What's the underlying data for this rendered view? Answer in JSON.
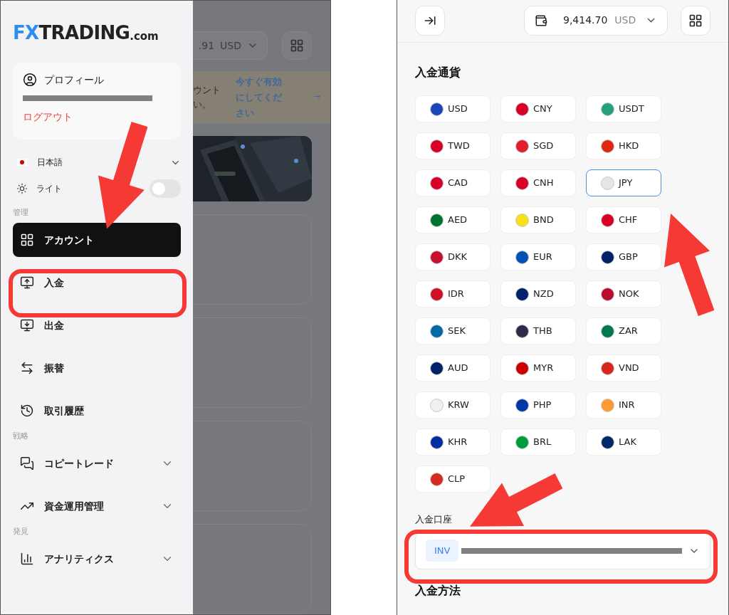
{
  "left_screen": {
    "logo": {
      "accent": "FX",
      "main": "TRADING",
      "suffix": ".com"
    },
    "profile": {
      "label": "プロフィール",
      "logout": "ログアウト"
    },
    "language": {
      "label": "日本語"
    },
    "theme": {
      "label": "ライト",
      "on": false
    },
    "sections": [
      {
        "title": "管理",
        "items": [
          {
            "label": "アカウント",
            "selected": true,
            "expandable": false
          },
          {
            "label": "入金",
            "selected": false,
            "expandable": false
          },
          {
            "label": "出金",
            "selected": false,
            "expandable": false
          },
          {
            "label": "振替",
            "selected": false,
            "expandable": false
          },
          {
            "label": "取引履歴",
            "selected": false,
            "expandable": false
          }
        ]
      },
      {
        "title": "戦略",
        "items": [
          {
            "label": "コピートレード",
            "selected": false,
            "expandable": true
          },
          {
            "label": "資金運用管理",
            "selected": false,
            "expandable": true
          }
        ]
      },
      {
        "title": "発見",
        "items": [
          {
            "label": "アナリティクス",
            "selected": false,
            "expandable": true
          }
        ]
      }
    ],
    "background_page": {
      "balance": ".91",
      "currency": "USD",
      "banner_lines": [
        "ウント",
        "い。"
      ],
      "link": "今すぐ有効にしてください",
      "link_arrow": "→"
    }
  },
  "right_screen": {
    "balance": "9,414.70",
    "currency": "USD",
    "currency_title": "入金通貨",
    "currencies": [
      {
        "code": "USD",
        "color": "#1a47b8",
        "selected": false
      },
      {
        "code": "CNY",
        "color": "#d80027",
        "selected": false
      },
      {
        "code": "USDT",
        "color": "#26a17b",
        "selected": false
      },
      {
        "code": "TWD",
        "color": "#d80027",
        "selected": false
      },
      {
        "code": "SGD",
        "color": "#e11d2e",
        "selected": false
      },
      {
        "code": "HKD",
        "color": "#de2910",
        "selected": false
      },
      {
        "code": "CAD",
        "color": "#d80027",
        "selected": false
      },
      {
        "code": "CNH",
        "color": "#d80027",
        "selected": false
      },
      {
        "code": "JPY",
        "color": "#e5e5e5",
        "selected": true
      },
      {
        "code": "AED",
        "color": "#00732f",
        "selected": false
      },
      {
        "code": "BND",
        "color": "#f7e017",
        "selected": false
      },
      {
        "code": "CHF",
        "color": "#d80027",
        "selected": false
      },
      {
        "code": "DKK",
        "color": "#c8102e",
        "selected": false
      },
      {
        "code": "EUR",
        "color": "#0052b4",
        "selected": false
      },
      {
        "code": "GBP",
        "color": "#012169",
        "selected": false
      },
      {
        "code": "IDR",
        "color": "#ce1126",
        "selected": false
      },
      {
        "code": "NZD",
        "color": "#012169",
        "selected": false
      },
      {
        "code": "NOK",
        "color": "#ba0c2f",
        "selected": false
      },
      {
        "code": "SEK",
        "color": "#006aa7",
        "selected": false
      },
      {
        "code": "THB",
        "color": "#2d2a4a",
        "selected": false
      },
      {
        "code": "ZAR",
        "color": "#007a4d",
        "selected": false
      },
      {
        "code": "AUD",
        "color": "#012169",
        "selected": false
      },
      {
        "code": "MYR",
        "color": "#cc0001",
        "selected": false
      },
      {
        "code": "VND",
        "color": "#da251d",
        "selected": false
      },
      {
        "code": "KRW",
        "color": "#f0f0f0",
        "selected": false
      },
      {
        "code": "PHP",
        "color": "#0038a8",
        "selected": false
      },
      {
        "code": "INR",
        "color": "#ff9933",
        "selected": false
      },
      {
        "code": "KHR",
        "color": "#032ea1",
        "selected": false
      },
      {
        "code": "BRL",
        "color": "#009c3b",
        "selected": false
      },
      {
        "code": "LAK",
        "color": "#002868",
        "selected": false
      },
      {
        "code": "CLP",
        "color": "#d52b1e",
        "selected": false
      }
    ],
    "account_title": "入金口座",
    "account_tag": "INV",
    "method_title": "入金方法"
  }
}
